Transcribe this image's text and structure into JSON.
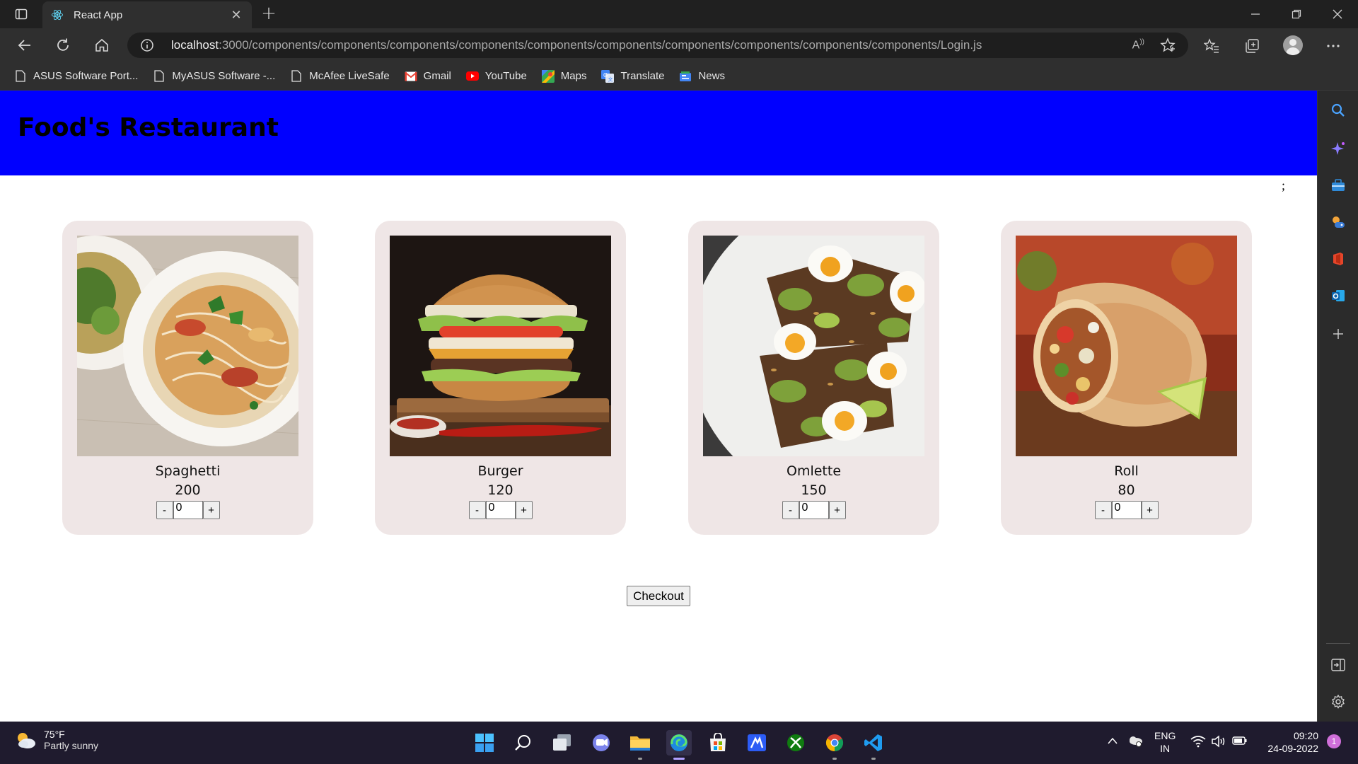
{
  "browser": {
    "tab_title": "React App",
    "url_host": "localhost",
    "url_path": ":3000/components/components/components/components/components/components/components/components/components/components/Login.js",
    "bookmarks": [
      {
        "label": "ASUS Software Port...",
        "icon": "page-icon"
      },
      {
        "label": "MyASUS Software -...",
        "icon": "page-icon"
      },
      {
        "label": "McAfee LiveSafe",
        "icon": "page-icon"
      },
      {
        "label": "Gmail",
        "icon": "gmail-icon"
      },
      {
        "label": "YouTube",
        "icon": "youtube-icon"
      },
      {
        "label": "Maps",
        "icon": "maps-icon"
      },
      {
        "label": "Translate",
        "icon": "translate-icon"
      },
      {
        "label": "News",
        "icon": "news-icon"
      }
    ]
  },
  "page": {
    "header_title": "Food's Restaurant",
    "stray_char": ";",
    "checkout_label": "Checkout",
    "items": [
      {
        "name": "Spaghetti",
        "price": "200",
        "qty": "0",
        "minus": "-",
        "plus": "+"
      },
      {
        "name": "Burger",
        "price": "120",
        "qty": "0",
        "minus": "-",
        "plus": "+"
      },
      {
        "name": "Omlette",
        "price": "150",
        "qty": "0",
        "minus": "-",
        "plus": "+"
      },
      {
        "name": "Roll",
        "price": "80",
        "qty": "0",
        "minus": "-",
        "plus": "+"
      }
    ]
  },
  "taskbar": {
    "weather_temp": "75°F",
    "weather_desc": "Partly sunny",
    "lang_top": "ENG",
    "lang_bottom": "IN",
    "time": "09:20",
    "date": "24-09-2022",
    "notification_count": "1"
  },
  "colors": {
    "header_bg": "#0000ff",
    "card_bg": "#efe6e6"
  }
}
